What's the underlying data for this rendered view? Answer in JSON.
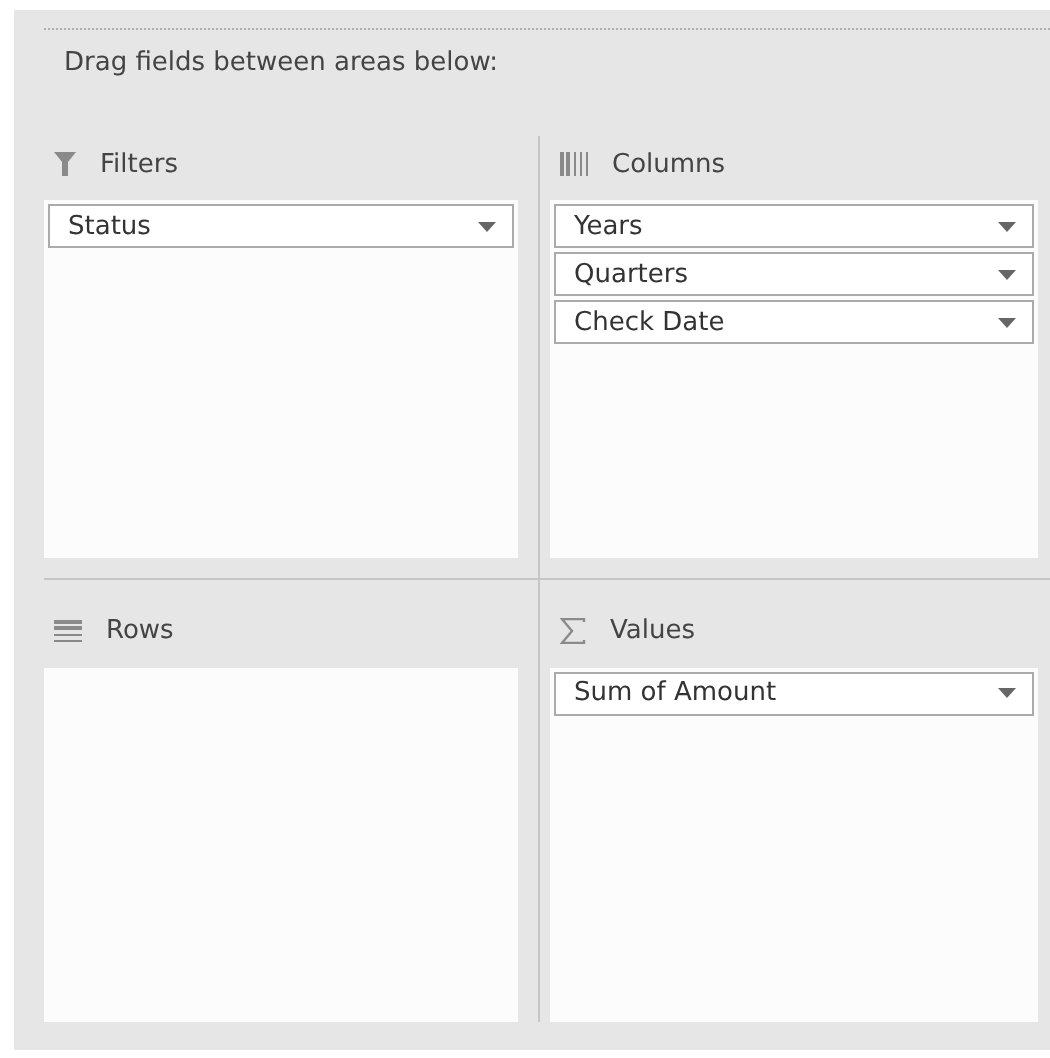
{
  "instruction": "Drag fields between areas below:",
  "areas": [
    {
      "kind": "filters",
      "label": "Filters",
      "fields": [
        "Status"
      ]
    },
    {
      "kind": "columns",
      "label": "Columns",
      "fields": [
        "Years",
        "Quarters",
        "Check Date"
      ]
    },
    {
      "kind": "rows",
      "label": "Rows"
    },
    {
      "kind": "values",
      "label": "Values",
      "fields": [
        "Sum of Amount"
      ]
    }
  ]
}
